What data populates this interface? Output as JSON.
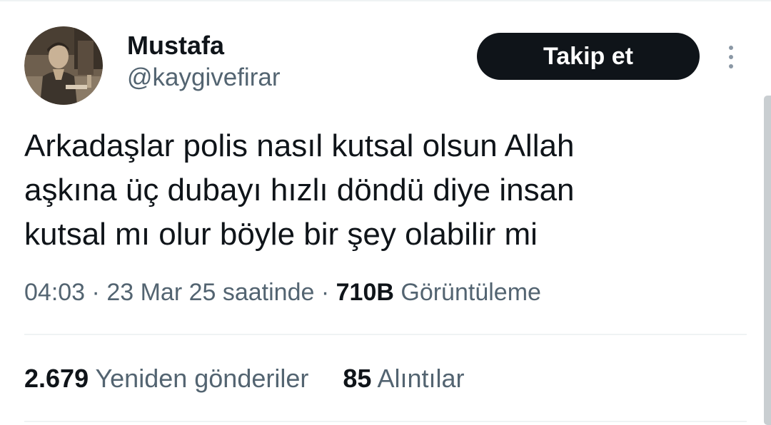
{
  "author": {
    "display_name": "Mustafa",
    "handle": "@kaygivefirar"
  },
  "actions": {
    "follow_label": "Takip et",
    "more_icon": "more-vertical-icon"
  },
  "tweet": {
    "lines": [
      "Arkadaşlar polis nasıl kutsal olsun Allah",
      "aşkına üç dubayı hızlı döndü diye insan",
      "kutsal mı olur böyle bir şey olabilir mi"
    ],
    "time": "04:03",
    "separator": "·",
    "date_text": "23 Mar 25 saatinde",
    "views_count": "710B",
    "views_label": "Görüntüleme"
  },
  "stats": {
    "retweets_count": "2.679",
    "retweets_label": "Yeniden gönderiler",
    "quotes_count": "85",
    "quotes_label": "Alıntılar"
  },
  "colors": {
    "text_primary": "#0f1419",
    "text_secondary": "#536471",
    "button_bg": "#0f1419",
    "divider": "#eff3f4"
  }
}
